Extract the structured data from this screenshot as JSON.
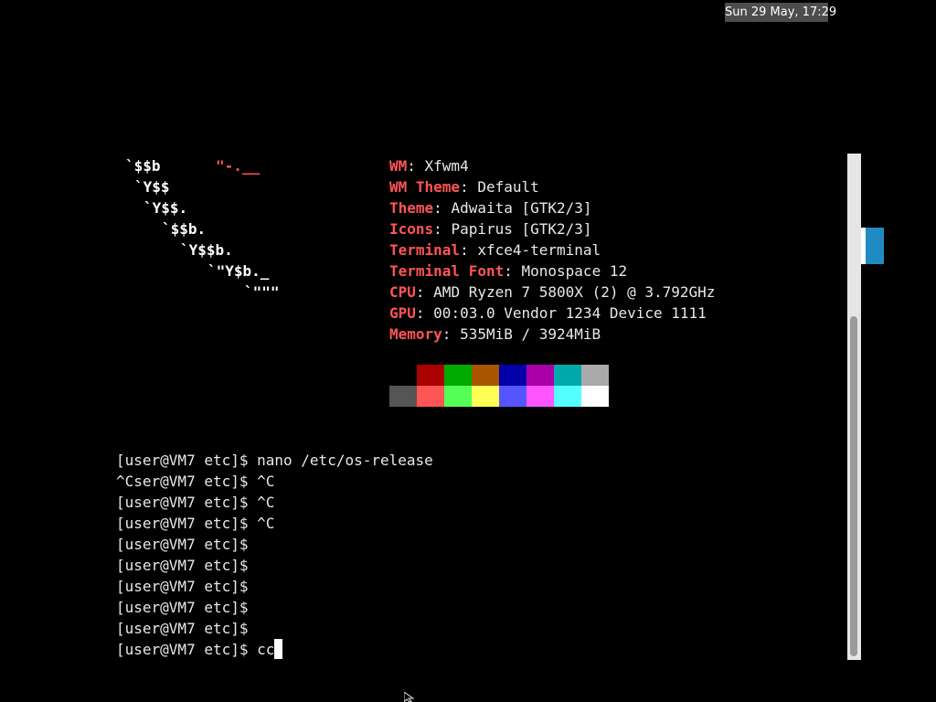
{
  "panel": {
    "clock": "Sun 29 May, 17:29"
  },
  "logo": {
    "lines": [
      {
        "a": "`$$b",
        "b": "\"-.__"
      },
      {
        "a": "`Y$$",
        "b": ""
      },
      {
        "a": "`Y$$.",
        "b": ""
      },
      {
        "a": "`$$b.",
        "b": ""
      },
      {
        "a": "`Y$$b.",
        "b": ""
      },
      {
        "a": "`\"Y$b._",
        "b": ""
      },
      {
        "a": "`\"\"\"",
        "b": ""
      }
    ]
  },
  "system_info": {
    "rows": [
      {
        "key": "WM",
        "value": ": Xfwm4"
      },
      {
        "key": "WM Theme",
        "value": ": Default"
      },
      {
        "key": "Theme",
        "value": ": Adwaita [GTK2/3]"
      },
      {
        "key": "Icons",
        "value": ": Papirus [GTK2/3]"
      },
      {
        "key": "Terminal",
        "value": ": xfce4-terminal"
      },
      {
        "key": "Terminal Font",
        "value": ": Monospace 12"
      },
      {
        "key": "CPU",
        "value": ": AMD Ryzen 7 5800X (2) @ 3.792GHz"
      },
      {
        "key": "GPU",
        "value": ": 00:03.0 Vendor 1234 Device 1111"
      },
      {
        "key": "Memory",
        "value": ": 535MiB / 3924MiB"
      }
    ]
  },
  "palette": {
    "colors": [
      "#000000",
      "#aa0000",
      "#00aa00",
      "#aa5500",
      "#0000aa",
      "#aa00aa",
      "#00aaaa",
      "#aaaaaa",
      "#555555",
      "#ff5555",
      "#55ff55",
      "#ffff55",
      "#5555ff",
      "#ff55ff",
      "#55ffff",
      "#ffffff"
    ]
  },
  "terminal": {
    "lines": [
      "[user@VM7 etc]$ nano /etc/os-release",
      "^Cser@VM7 etc]$ ^C",
      "[user@VM7 etc]$ ^C",
      "[user@VM7 etc]$ ^C",
      "[user@VM7 etc]$",
      "[user@VM7 etc]$",
      "[user@VM7 etc]$",
      "[user@VM7 etc]$",
      "[user@VM7 etc]$"
    ],
    "current_prompt": "[user@VM7 etc]$ cc"
  }
}
